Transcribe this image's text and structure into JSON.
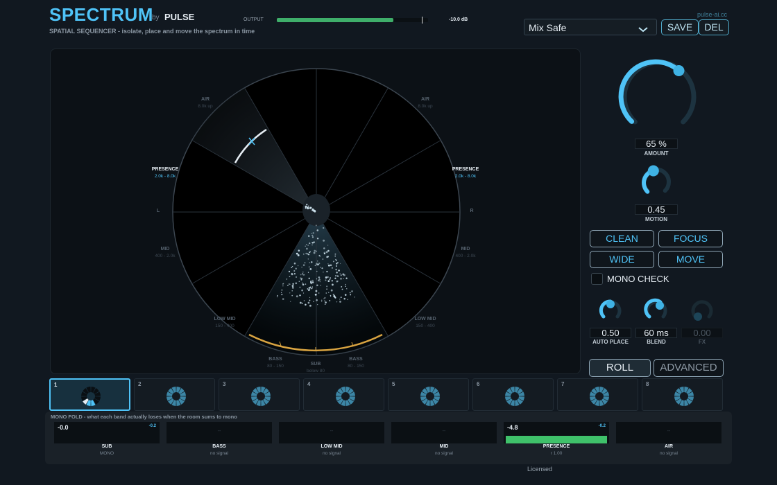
{
  "header": {
    "title": "SPECTRUM",
    "by": "by",
    "brand": "PULSE",
    "subtitle": "SPATIAL SEQUENCER  -  isolate, place and move the spectrum in time",
    "output_label": "OUTPUT",
    "output_level": 0.77,
    "output_db": "-10.0 dB",
    "site": "pulse-ai.cc",
    "preset": "Mix Safe",
    "save": "SAVE",
    "del": "DEL"
  },
  "wheel": {
    "labels": [
      {
        "name": "AIR",
        "range": "8.0k up",
        "active": false
      },
      {
        "name": "AIR",
        "range": "8.0k up",
        "active": false
      },
      {
        "name": "PRESENCE",
        "range": "2.0k - 8.0k",
        "active": true
      },
      {
        "name": "PRESENCE",
        "range": "2.0k - 8.0k",
        "active": true
      },
      {
        "name": "MID",
        "range": "400 - 2.0k",
        "active": false
      },
      {
        "name": "MID",
        "range": "400 - 2.0k",
        "active": false
      },
      {
        "name": "LOW MID",
        "range": "150 - 400",
        "active": false
      },
      {
        "name": "LOW MID",
        "range": "150 - 400",
        "active": false
      },
      {
        "name": "BASS",
        "range": "80 - 150",
        "active": false
      },
      {
        "name": "BASS",
        "range": "80 - 150",
        "active": false
      },
      {
        "name": "SUB",
        "range": "below 80",
        "active": false
      }
    ],
    "left": "L",
    "right": "R"
  },
  "controls": {
    "amount": {
      "value": "65 %",
      "label": "AMOUNT",
      "level": 0.65
    },
    "motion": {
      "value": "0.45",
      "label": "MOTION",
      "level": 0.45
    },
    "buttons": [
      "CLEAN",
      "FOCUS",
      "WIDE",
      "MOVE"
    ],
    "mono_check": "MONO CHECK",
    "auto_place": {
      "value": "0.50",
      "label": "AUTO PLACE"
    },
    "blend": {
      "value": "60 ms",
      "label": "BLEND"
    },
    "fx": {
      "value": "0.00",
      "label": "FX"
    },
    "roll": "ROLL",
    "advanced": "ADVANCED"
  },
  "slots": [
    "1",
    "2",
    "3",
    "4",
    "5",
    "6",
    "7",
    "8"
  ],
  "mono_fold": {
    "label": "MONO FOLD  -  what each band actually loses when the room sums to mono",
    "bands": [
      {
        "value": "-0.0",
        "delta": "-0.2",
        "name": "SUB",
        "status": "MONO"
      },
      {
        "value": "--",
        "delta": "",
        "name": "BASS",
        "status": "no signal"
      },
      {
        "value": "--",
        "delta": "",
        "name": "LOW MID",
        "status": "no signal"
      },
      {
        "value": "--",
        "delta": "",
        "name": "MID",
        "status": "no signal"
      },
      {
        "value": "-4.8",
        "delta": "-0.2",
        "name": "PRESENCE",
        "status": "r 1.00"
      },
      {
        "value": "--",
        "delta": "",
        "name": "AIR",
        "status": "no signal"
      }
    ]
  },
  "footer": {
    "licensed": "Licensed"
  },
  "colors": {
    "accent": "#4fc3f7",
    "meter": "#3fae6a",
    "bass_arc": "#d9a441"
  }
}
